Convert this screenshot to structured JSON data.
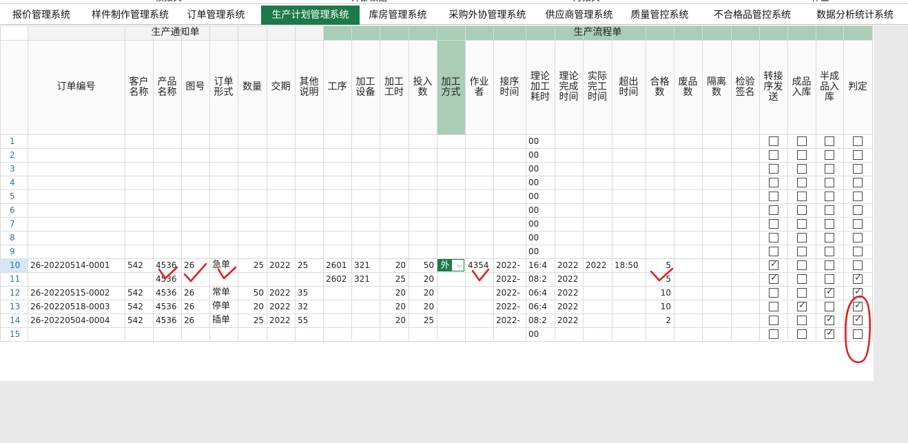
{
  "header_partial": [
    "核报关",
    "外部数据",
    "月报关",
    "作业"
  ],
  "tabs": [
    {
      "label": "报价管理系统",
      "active": false
    },
    {
      "label": "样件制作管理系统",
      "active": false
    },
    {
      "label": "订单管理系统",
      "active": false
    },
    {
      "label": "生产计划管理系统",
      "active": true
    },
    {
      "label": "库房管理系统",
      "active": false
    },
    {
      "label": "采购外协管理系统",
      "active": false
    },
    {
      "label": "供应商管理系统",
      "active": false
    },
    {
      "label": "质量管控系统",
      "active": false
    },
    {
      "label": "不合格品管控系统",
      "active": false
    },
    {
      "label": "数据分析统计系统",
      "active": false
    }
  ],
  "bands": {
    "notice": "生产通知单",
    "flow": "生产流程单"
  },
  "columns": [
    "订单编号",
    "客户名称",
    "产品名称",
    "图号",
    "订单形式",
    "数量",
    "交期",
    "其他说明",
    "工序",
    "加工设备",
    "加工工时",
    "投入数",
    "加工方式",
    "作业者",
    "接序时间",
    "理论加工耗时",
    "理论完成时间",
    "实际完工时间",
    "超出时间",
    "合格数",
    "废品数",
    "隔离数",
    "检验签名",
    "转接序发送",
    "成品入库",
    "半成品入库",
    "判定"
  ],
  "rows": [
    {
      "n": "1",
      "c": {
        "theory": "00"
      },
      "cb": [
        false,
        false,
        false,
        false
      ]
    },
    {
      "n": "2",
      "c": {
        "theory": "00"
      },
      "cb": [
        false,
        false,
        false,
        false
      ]
    },
    {
      "n": "3",
      "c": {
        "theory": "00"
      },
      "cb": [
        false,
        false,
        false,
        false
      ]
    },
    {
      "n": "4",
      "c": {
        "theory": "00"
      },
      "cb": [
        false,
        false,
        false,
        false
      ]
    },
    {
      "n": "5",
      "c": {
        "theory": "00"
      },
      "cb": [
        false,
        false,
        false,
        false
      ]
    },
    {
      "n": "6",
      "c": {
        "theory": "00"
      },
      "cb": [
        false,
        false,
        false,
        false
      ]
    },
    {
      "n": "7",
      "c": {
        "theory": "00"
      },
      "cb": [
        false,
        false,
        false,
        false
      ]
    },
    {
      "n": "8",
      "c": {
        "theory": "00"
      },
      "cb": [
        false,
        false,
        false,
        false
      ]
    },
    {
      "n": "9",
      "c": {
        "theory": "00"
      },
      "cb": [
        false,
        false,
        false,
        false
      ]
    },
    {
      "n": "10",
      "c": {
        "order": "26-20220514-0001",
        "cust": "542",
        "prod": "4536",
        "draw": "26",
        "form": "急单",
        "qty": "25",
        "due": "2022",
        "note": "25",
        "proc": "2601",
        "equip": "321",
        "hours": "20",
        "input": "50",
        "method": "外",
        "worker": "4354",
        "recv": "2022-",
        "theory": "16:4",
        "tdone": "2022",
        "adone": "2022",
        "over": "18:50",
        "ok": "5"
      },
      "cb": [
        true,
        false,
        false,
        false
      ]
    },
    {
      "n": "11",
      "c": {
        "prod": "4536",
        "proc": "2602",
        "equip": "321",
        "hours": "25",
        "input": "20",
        "recv": "2022-",
        "theory": "08:2",
        "tdone": "2022",
        "ok": "5"
      },
      "cb": [
        true,
        false,
        false,
        true
      ]
    },
    {
      "n": "12",
      "c": {
        "order": "26-20220515-0002",
        "cust": "542",
        "prod": "4536",
        "draw": "26",
        "form": "常单",
        "qty": "50",
        "due": "2022",
        "note": "35",
        "hours": "20",
        "input": "20",
        "recv": "2022-",
        "theory": "06:4",
        "tdone": "2022",
        "ok": "10"
      },
      "cb": [
        false,
        false,
        true,
        true
      ]
    },
    {
      "n": "13",
      "c": {
        "order": "26-20220518-0003",
        "cust": "542",
        "prod": "4536",
        "draw": "26",
        "form": "停单",
        "qty": "20",
        "due": "2022",
        "note": "32",
        "hours": "20",
        "input": "20",
        "recv": "2022-",
        "theory": "06:4",
        "tdone": "2022",
        "ok": "10"
      },
      "cb": [
        false,
        true,
        false,
        true
      ]
    },
    {
      "n": "14",
      "c": {
        "order": "26-20220504-0004",
        "cust": "542",
        "prod": "4536",
        "draw": "26",
        "form": "插单",
        "qty": "25",
        "due": "2022",
        "note": "55",
        "hours": "20",
        "input": "25",
        "recv": "2022-",
        "theory": "08:2",
        "tdone": "2022",
        "ok": "2"
      },
      "cb": [
        false,
        false,
        true,
        true
      ]
    },
    {
      "n": "15",
      "c": {
        "theory": "00"
      },
      "cb": [
        false,
        false,
        true,
        false
      ]
    }
  ],
  "colors": {
    "accent": "#1d7a48",
    "band_green": "#a9cdb6",
    "annotation": "#e02020"
  },
  "icons": {
    "dropdown": "chevron-down-icon",
    "checkbox": "checkbox-icon"
  }
}
